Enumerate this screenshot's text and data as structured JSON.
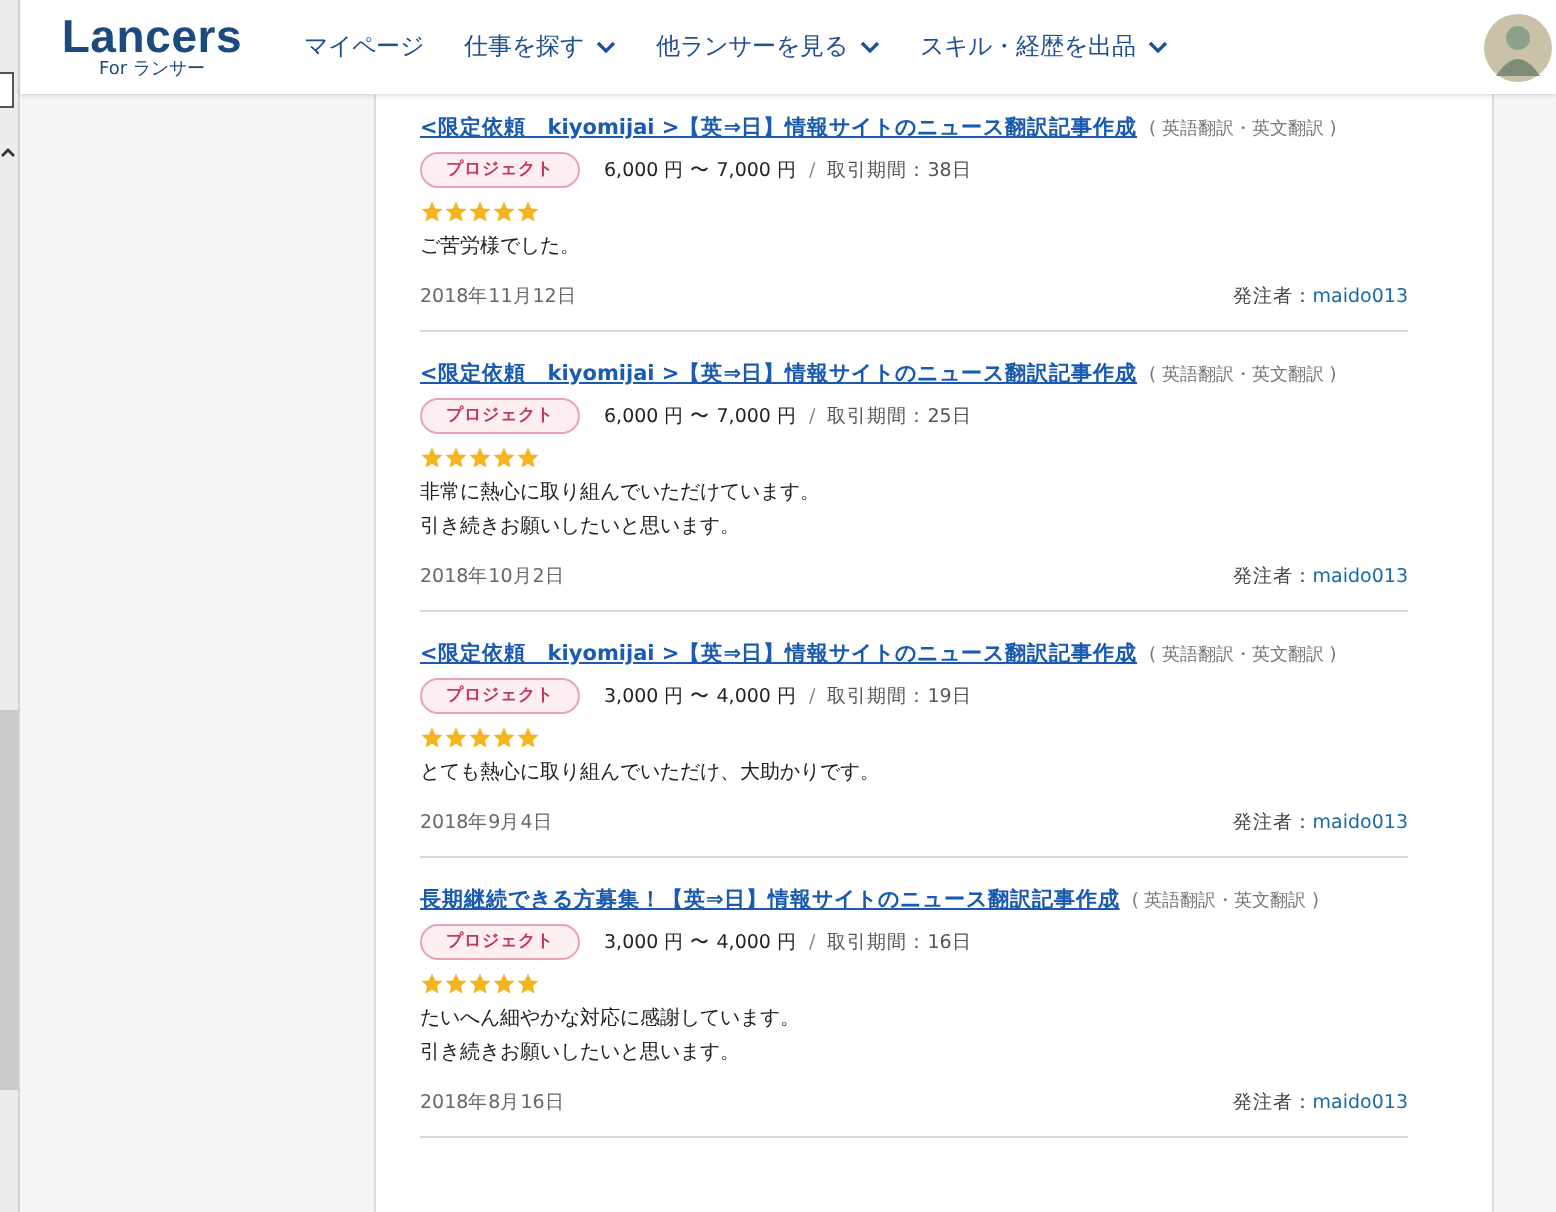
{
  "header": {
    "logo": "Lancers",
    "logo_sub": "For ランサー",
    "nav": [
      {
        "label": "マイページ",
        "dropdown": false
      },
      {
        "label": "仕事を探す",
        "dropdown": true
      },
      {
        "label": "他ランサーを見る",
        "dropdown": true
      },
      {
        "label": "スキル・経歴を出品",
        "dropdown": true
      }
    ]
  },
  "reviews": [
    {
      "title": "<限定依頼　kiyomijai >【英⇒日】情報サイトのニュース翻訳記事作成",
      "category": "( 英語翻訳・英文翻訳 )",
      "badge": "プロジェクト",
      "price": "6,000 円 〜 7,000 円",
      "separator": "/",
      "period": "取引期間：38日",
      "stars": 5,
      "comment": [
        "ご苦労様でした。"
      ],
      "date": "2018年11月12日",
      "client_label": "発注者：",
      "client": "maido013"
    },
    {
      "title": "<限定依頼　kiyomijai >【英⇒日】情報サイトのニュース翻訳記事作成",
      "category": "( 英語翻訳・英文翻訳 )",
      "badge": "プロジェクト",
      "price": "6,000 円 〜 7,000 円",
      "separator": "/",
      "period": "取引期間：25日",
      "stars": 5,
      "comment": [
        "非常に熱心に取り組んでいただけています。",
        "引き続きお願いしたいと思います。"
      ],
      "date": "2018年10月2日",
      "client_label": "発注者：",
      "client": "maido013"
    },
    {
      "title": "<限定依頼　kiyomijai >【英⇒日】情報サイトのニュース翻訳記事作成",
      "category": "( 英語翻訳・英文翻訳 )",
      "badge": "プロジェクト",
      "price": "3,000 円 〜 4,000 円",
      "separator": "/",
      "period": "取引期間：19日",
      "stars": 5,
      "comment": [
        "とても熱心に取り組んでいただけ、大助かりです。"
      ],
      "date": "2018年9月4日",
      "client_label": "発注者：",
      "client": "maido013"
    },
    {
      "title": "長期継続できる方募集！【英⇒日】情報サイトのニュース翻訳記事作成",
      "category": "( 英語翻訳・英文翻訳 )",
      "badge": "プロジェクト",
      "price": "3,000 円 〜 4,000 円",
      "separator": "/",
      "period": "取引期間：16日",
      "stars": 5,
      "comment": [
        "たいへん細やかな対応に感謝しています。",
        "引き続きお願いしたいと思います。"
      ],
      "date": "2018年8月16日",
      "client_label": "発注者：",
      "client": "maido013"
    }
  ]
}
